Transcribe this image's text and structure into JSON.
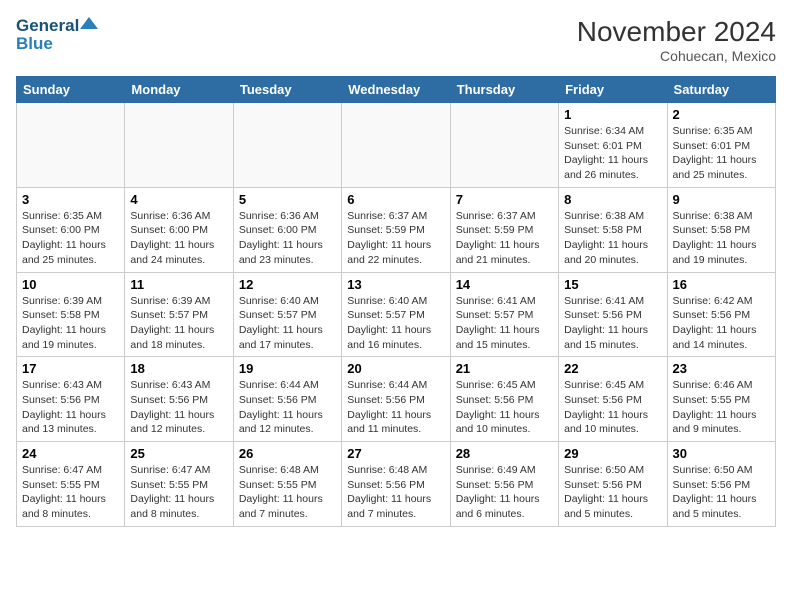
{
  "header": {
    "logo_line1": "General",
    "logo_line2": "Blue",
    "month_title": "November 2024",
    "location": "Cohuecan, Mexico"
  },
  "weekdays": [
    "Sunday",
    "Monday",
    "Tuesday",
    "Wednesday",
    "Thursday",
    "Friday",
    "Saturday"
  ],
  "weeks": [
    [
      {
        "day": "",
        "info": ""
      },
      {
        "day": "",
        "info": ""
      },
      {
        "day": "",
        "info": ""
      },
      {
        "day": "",
        "info": ""
      },
      {
        "day": "",
        "info": ""
      },
      {
        "day": "1",
        "info": "Sunrise: 6:34 AM\nSunset: 6:01 PM\nDaylight: 11 hours and 26 minutes."
      },
      {
        "day": "2",
        "info": "Sunrise: 6:35 AM\nSunset: 6:01 PM\nDaylight: 11 hours and 25 minutes."
      }
    ],
    [
      {
        "day": "3",
        "info": "Sunrise: 6:35 AM\nSunset: 6:00 PM\nDaylight: 11 hours and 25 minutes."
      },
      {
        "day": "4",
        "info": "Sunrise: 6:36 AM\nSunset: 6:00 PM\nDaylight: 11 hours and 24 minutes."
      },
      {
        "day": "5",
        "info": "Sunrise: 6:36 AM\nSunset: 6:00 PM\nDaylight: 11 hours and 23 minutes."
      },
      {
        "day": "6",
        "info": "Sunrise: 6:37 AM\nSunset: 5:59 PM\nDaylight: 11 hours and 22 minutes."
      },
      {
        "day": "7",
        "info": "Sunrise: 6:37 AM\nSunset: 5:59 PM\nDaylight: 11 hours and 21 minutes."
      },
      {
        "day": "8",
        "info": "Sunrise: 6:38 AM\nSunset: 5:58 PM\nDaylight: 11 hours and 20 minutes."
      },
      {
        "day": "9",
        "info": "Sunrise: 6:38 AM\nSunset: 5:58 PM\nDaylight: 11 hours and 19 minutes."
      }
    ],
    [
      {
        "day": "10",
        "info": "Sunrise: 6:39 AM\nSunset: 5:58 PM\nDaylight: 11 hours and 19 minutes."
      },
      {
        "day": "11",
        "info": "Sunrise: 6:39 AM\nSunset: 5:57 PM\nDaylight: 11 hours and 18 minutes."
      },
      {
        "day": "12",
        "info": "Sunrise: 6:40 AM\nSunset: 5:57 PM\nDaylight: 11 hours and 17 minutes."
      },
      {
        "day": "13",
        "info": "Sunrise: 6:40 AM\nSunset: 5:57 PM\nDaylight: 11 hours and 16 minutes."
      },
      {
        "day": "14",
        "info": "Sunrise: 6:41 AM\nSunset: 5:57 PM\nDaylight: 11 hours and 15 minutes."
      },
      {
        "day": "15",
        "info": "Sunrise: 6:41 AM\nSunset: 5:56 PM\nDaylight: 11 hours and 15 minutes."
      },
      {
        "day": "16",
        "info": "Sunrise: 6:42 AM\nSunset: 5:56 PM\nDaylight: 11 hours and 14 minutes."
      }
    ],
    [
      {
        "day": "17",
        "info": "Sunrise: 6:43 AM\nSunset: 5:56 PM\nDaylight: 11 hours and 13 minutes."
      },
      {
        "day": "18",
        "info": "Sunrise: 6:43 AM\nSunset: 5:56 PM\nDaylight: 11 hours and 12 minutes."
      },
      {
        "day": "19",
        "info": "Sunrise: 6:44 AM\nSunset: 5:56 PM\nDaylight: 11 hours and 12 minutes."
      },
      {
        "day": "20",
        "info": "Sunrise: 6:44 AM\nSunset: 5:56 PM\nDaylight: 11 hours and 11 minutes."
      },
      {
        "day": "21",
        "info": "Sunrise: 6:45 AM\nSunset: 5:56 PM\nDaylight: 11 hours and 10 minutes."
      },
      {
        "day": "22",
        "info": "Sunrise: 6:45 AM\nSunset: 5:56 PM\nDaylight: 11 hours and 10 minutes."
      },
      {
        "day": "23",
        "info": "Sunrise: 6:46 AM\nSunset: 5:55 PM\nDaylight: 11 hours and 9 minutes."
      }
    ],
    [
      {
        "day": "24",
        "info": "Sunrise: 6:47 AM\nSunset: 5:55 PM\nDaylight: 11 hours and 8 minutes."
      },
      {
        "day": "25",
        "info": "Sunrise: 6:47 AM\nSunset: 5:55 PM\nDaylight: 11 hours and 8 minutes."
      },
      {
        "day": "26",
        "info": "Sunrise: 6:48 AM\nSunset: 5:55 PM\nDaylight: 11 hours and 7 minutes."
      },
      {
        "day": "27",
        "info": "Sunrise: 6:48 AM\nSunset: 5:56 PM\nDaylight: 11 hours and 7 minutes."
      },
      {
        "day": "28",
        "info": "Sunrise: 6:49 AM\nSunset: 5:56 PM\nDaylight: 11 hours and 6 minutes."
      },
      {
        "day": "29",
        "info": "Sunrise: 6:50 AM\nSunset: 5:56 PM\nDaylight: 11 hours and 5 minutes."
      },
      {
        "day": "30",
        "info": "Sunrise: 6:50 AM\nSunset: 5:56 PM\nDaylight: 11 hours and 5 minutes."
      }
    ]
  ]
}
